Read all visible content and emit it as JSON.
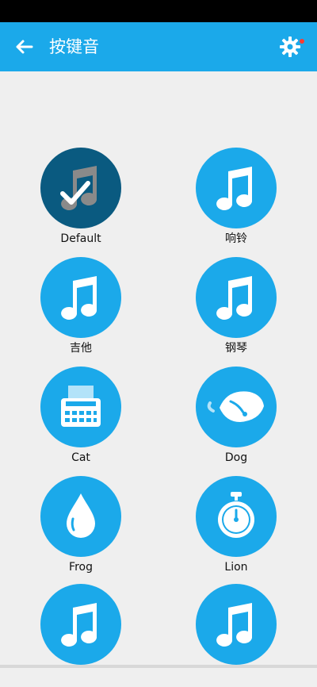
{
  "header": {
    "title": "按键音"
  },
  "icons": {
    "back": "arrow-left-icon",
    "settings": "gear-icon"
  },
  "colors": {
    "accent": "#1ba9ea",
    "selected": "#0a5a80",
    "notify_dot": "#ff3b30"
  },
  "sounds": [
    {
      "label": "Default",
      "icon": "music-note-check-icon",
      "selected": true
    },
    {
      "label": "响铃",
      "icon": "music-note-icon"
    },
    {
      "label": "吉他",
      "icon": "music-note-icon"
    },
    {
      "label": "钢琴",
      "icon": "music-note-icon"
    },
    {
      "label": "Cat",
      "icon": "typewriter-icon"
    },
    {
      "label": "Dog",
      "icon": "leaf-icon"
    },
    {
      "label": "Frog",
      "icon": "water-drop-icon"
    },
    {
      "label": "Lion",
      "icon": "stopwatch-icon"
    },
    {
      "label": "",
      "icon": "music-note-icon"
    },
    {
      "label": "",
      "icon": "music-note-icon"
    }
  ]
}
